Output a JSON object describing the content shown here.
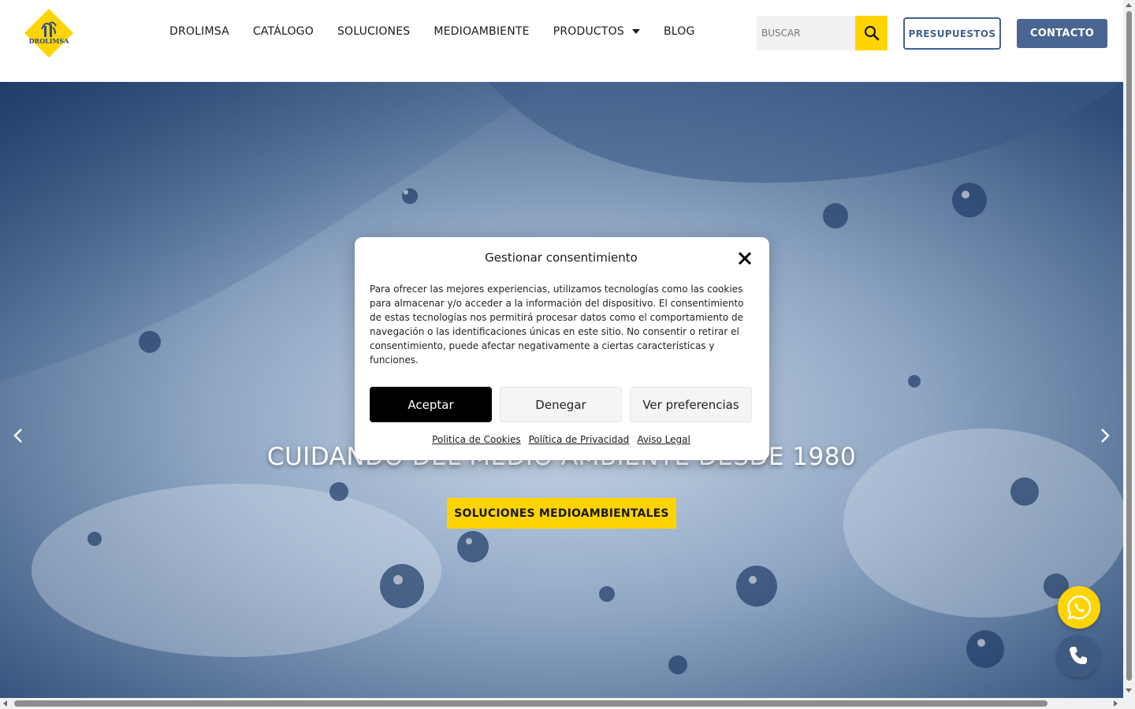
{
  "brand": {
    "logo_text": "DROLIMSA",
    "primary_yellow": "#ffd400",
    "primary_blue": "#4a6591"
  },
  "nav": {
    "items": [
      {
        "label": "DROLIMSA"
      },
      {
        "label": "CATÁLOGO"
      },
      {
        "label": "SOLUCIONES"
      },
      {
        "label": "MEDIOAMBIENTE"
      },
      {
        "label": "PRODUCTOS",
        "has_dropdown": true
      },
      {
        "label": "BLOG"
      }
    ]
  },
  "search": {
    "placeholder": "BUSCAR",
    "icon": "search-icon"
  },
  "header_buttons": {
    "presupuestos": "PRESUPUESTOS",
    "contacto": "CONTACTO"
  },
  "hero": {
    "title": "CUIDANDO DEL MEDIO AMBIENTE DESDE 1980",
    "cta": "SOLUCIONES MEDIOAMBIENTALES",
    "prev_icon": "chevron-left-icon",
    "next_icon": "chevron-right-icon"
  },
  "consent": {
    "title": "Gestionar consentimiento",
    "body": "Para ofrecer las mejores experiencias, utilizamos tecnologías como las cookies para almacenar y/o acceder a la información del dispositivo. El consentimiento de estas tecnologías nos permitirá procesar datos como el comportamiento de navegación o las identificaciones únicas en este sitio. No consentir o retirar el consentimiento, puede afectar negativamente a ciertas características y funciones.",
    "accept": "Aceptar",
    "deny": "Denegar",
    "preferences": "Ver preferencias",
    "links": [
      "Politica de Cookies",
      "Política de Privacidad",
      "Aviso Legal"
    ]
  },
  "floating": {
    "whatsapp_icon": "whatsapp-icon",
    "phone_icon": "phone-icon"
  }
}
